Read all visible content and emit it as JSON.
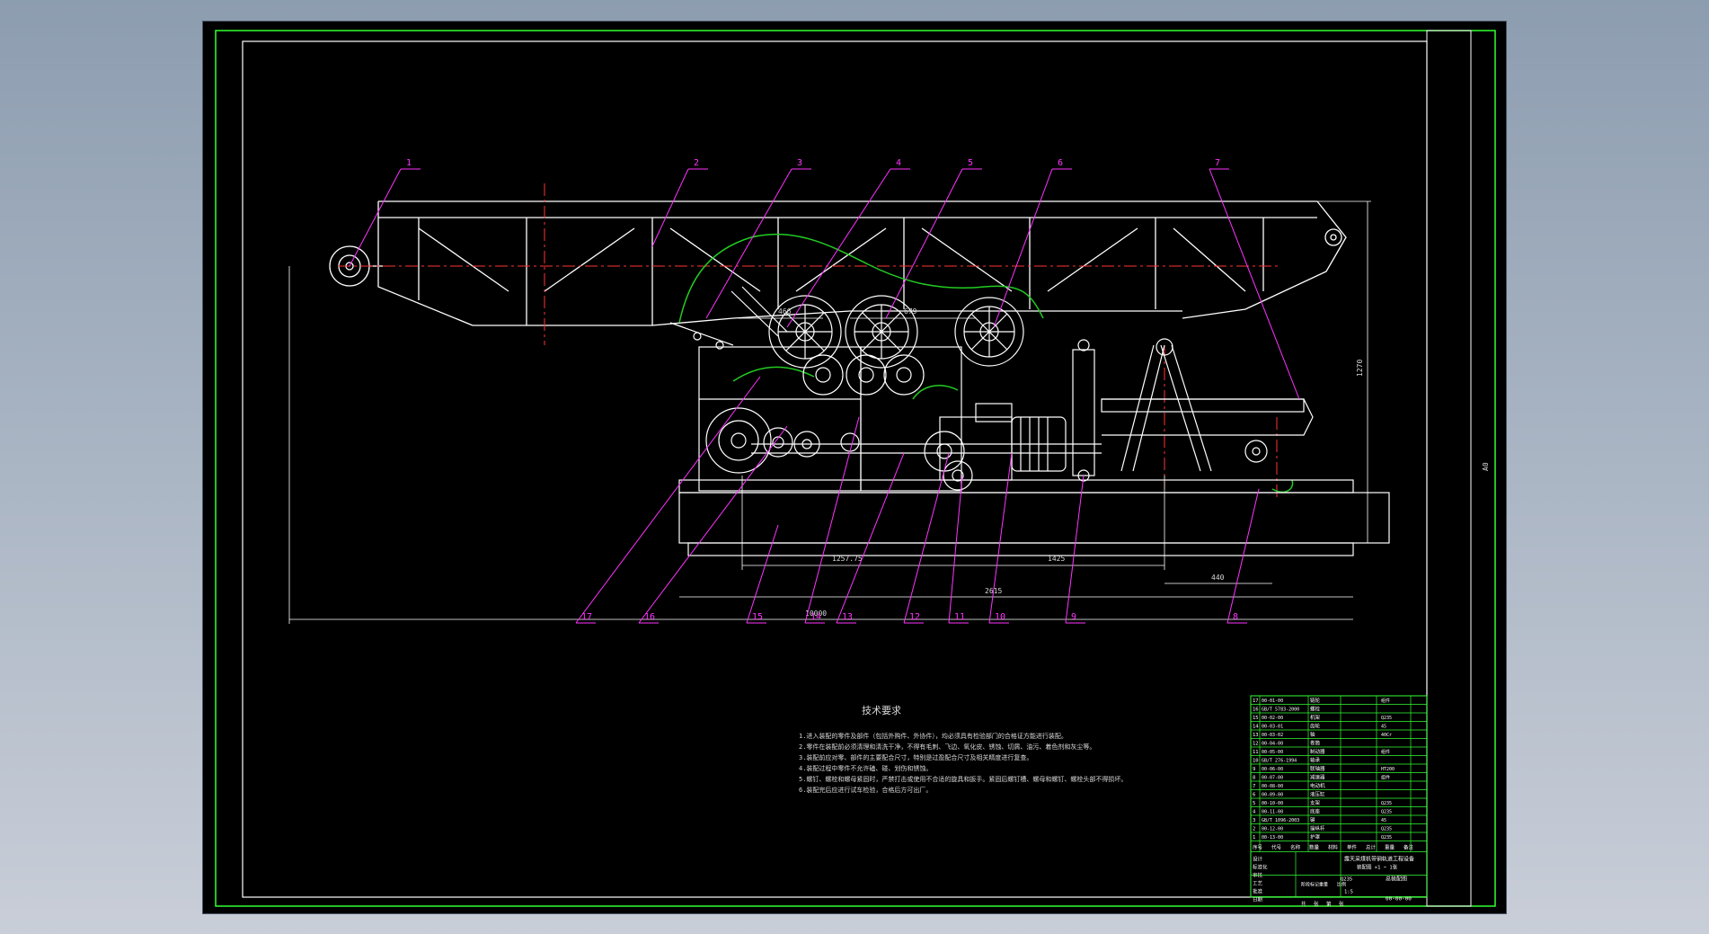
{
  "drawing": {
    "colors": {
      "background": "#000000",
      "outline": "#ffffff",
      "callout": "#ff33ff",
      "border": "#33ff33",
      "centerline": "#ff3333",
      "cover": "#22cc22"
    },
    "callouts": [
      "1",
      "2",
      "3",
      "4",
      "5",
      "6",
      "7",
      "8",
      "9",
      "10",
      "11",
      "12",
      "13",
      "14",
      "15",
      "16",
      "17"
    ],
    "dimensions": {
      "d_top_left": "466",
      "d_top_right": "679",
      "d_mid_left": "1257.75",
      "d_mid_right": "1425",
      "d_lower": "2615",
      "d_overall": "10000",
      "d_right_small": "440",
      "d_vertical": "1270"
    },
    "notes": {
      "title": "技术要求",
      "lines": [
        "1.进入装配的零件及部件（包括外购件、外协件），均必须具有检验部门的合格证方能进行装配。",
        "2.零件在装配前必须清理和清洗干净，不得有毛刺、飞边、氧化皮、锈蚀、切屑、油污、着色剂和灰尘等。",
        "3.装配前应对零、部件的主要配合尺寸，特别是过盈配合尺寸及相关精度进行复查。",
        "4.装配过程中零件不允许磕、碰、划伤和锈蚀。",
        "5.螺钉、螺栓和螺母紧固时，严禁打击或使用不合适的旋具和扳手。紧固后螺钉槽、螺母和螺钉、螺栓头部不得损坏。",
        "6.装配完后应进行试车检验，合格后方可出厂。"
      ]
    },
    "side_label": "A0",
    "title_block": {
      "project": "露天采煤机带钢轨道工程设备",
      "subtitle": "装配图 ×1 ~ 1张",
      "drawing_name": "总装配图",
      "drawing_no": "00-00-00",
      "scale": "1:5",
      "material_code": "Q235",
      "header_cells": [
        "序号",
        "代号",
        "名称",
        "数量",
        "材料",
        "单件",
        "总计",
        "重量",
        "备注"
      ],
      "sign_cells": [
        "设计",
        "标准化",
        "审核",
        "工艺",
        "批准",
        "日期"
      ],
      "info_cells": [
        "阶段标记",
        "重量",
        "比例"
      ],
      "footer_cells": [
        "共",
        "张",
        "第",
        "张"
      ],
      "parts": [
        {
          "code": "00-01-00",
          "name": "链轮",
          "material": "组件"
        },
        {
          "code": "GB/T 5783-2000",
          "name": "螺栓",
          "material": ""
        },
        {
          "code": "00-02-00",
          "name": "机架",
          "material": "Q235"
        },
        {
          "code": "00-03-01",
          "name": "齿轮",
          "material": "45"
        },
        {
          "code": "00-03-02",
          "name": "轴",
          "material": "40Cr"
        },
        {
          "code": "00-04-00",
          "name": "卷筒",
          "material": ""
        },
        {
          "code": "00-05-00",
          "name": "制动器",
          "material": "组件"
        },
        {
          "code": "GB/T 276-1994",
          "name": "轴承",
          "material": ""
        },
        {
          "code": "00-06-00",
          "name": "联轴器",
          "material": "HT200"
        },
        {
          "code": "00-07-00",
          "name": "减速器",
          "material": "组件"
        },
        {
          "code": "00-08-00",
          "name": "电动机",
          "material": ""
        },
        {
          "code": "00-09-00",
          "name": "液压缸",
          "material": ""
        },
        {
          "code": "00-10-00",
          "name": "支架",
          "material": "Q235"
        },
        {
          "code": "00-11-00",
          "name": "底座",
          "material": "Q235"
        },
        {
          "code": "GB/T 1096-2003",
          "name": "键",
          "material": "45"
        },
        {
          "code": "00-12-00",
          "name": "操纵杆",
          "material": "Q235"
        },
        {
          "code": "00-13-00",
          "name": "护罩",
          "material": "Q235"
        }
      ]
    }
  }
}
